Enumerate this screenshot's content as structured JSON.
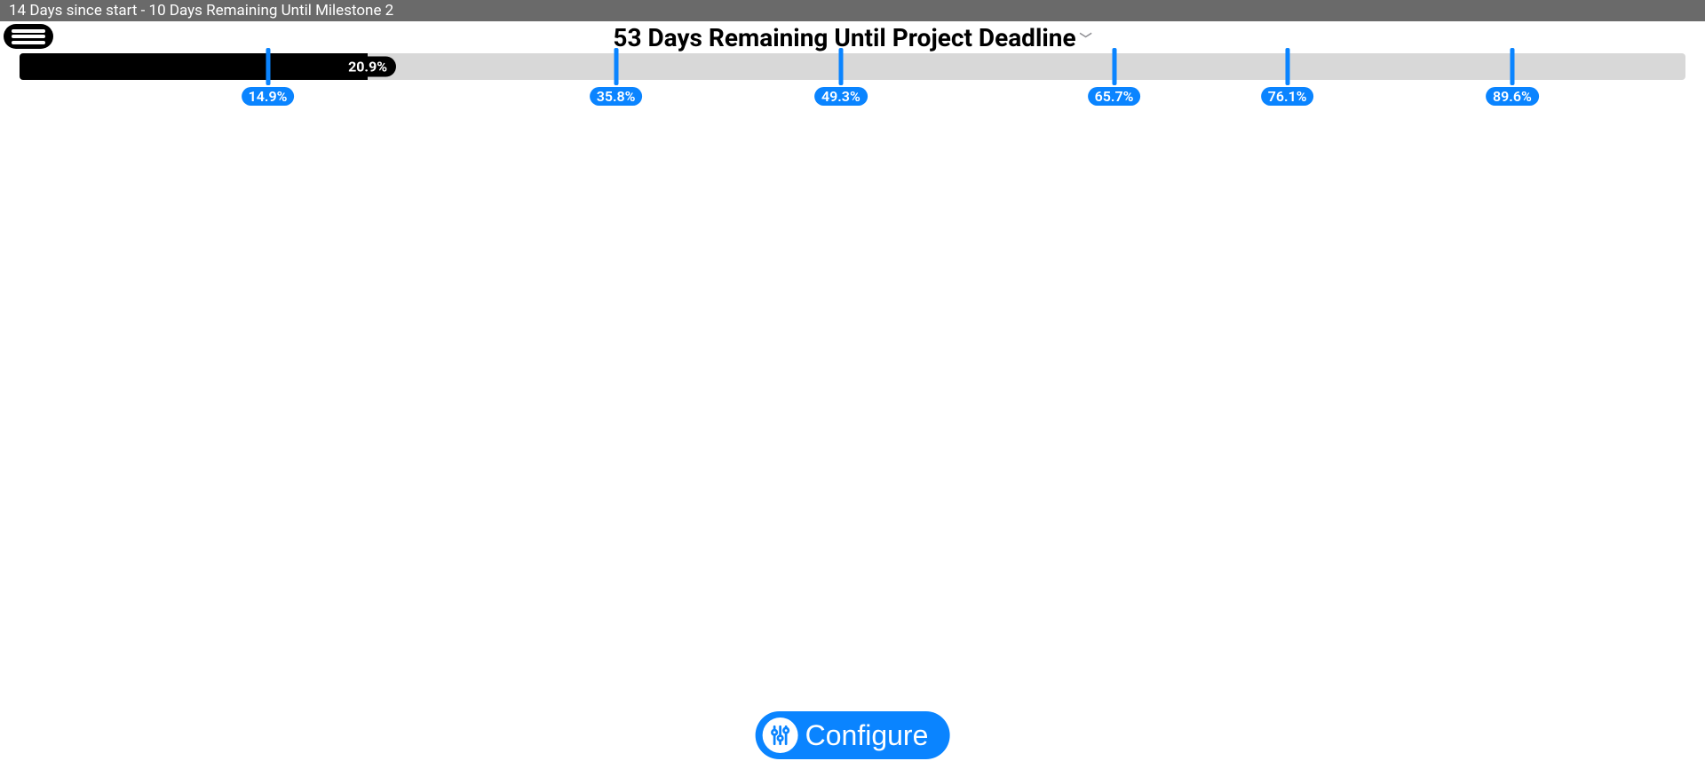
{
  "titlebar": "14 Days since start - 10 Days Remaining Until Milestone 2",
  "headline": "53 Days Remaining Until Project Deadline",
  "progress": {
    "percent": 20.9,
    "percent_label": "20.9%"
  },
  "milestones": [
    {
      "pct": 14.9,
      "label": "14.9%"
    },
    {
      "pct": 35.8,
      "label": "35.8%"
    },
    {
      "pct": 49.3,
      "label": "49.3%"
    },
    {
      "pct": 65.7,
      "label": "65.7%"
    },
    {
      "pct": 76.1,
      "label": "76.1%"
    },
    {
      "pct": 89.6,
      "label": "89.6%"
    }
  ],
  "buttons": {
    "configure": "Configure"
  }
}
